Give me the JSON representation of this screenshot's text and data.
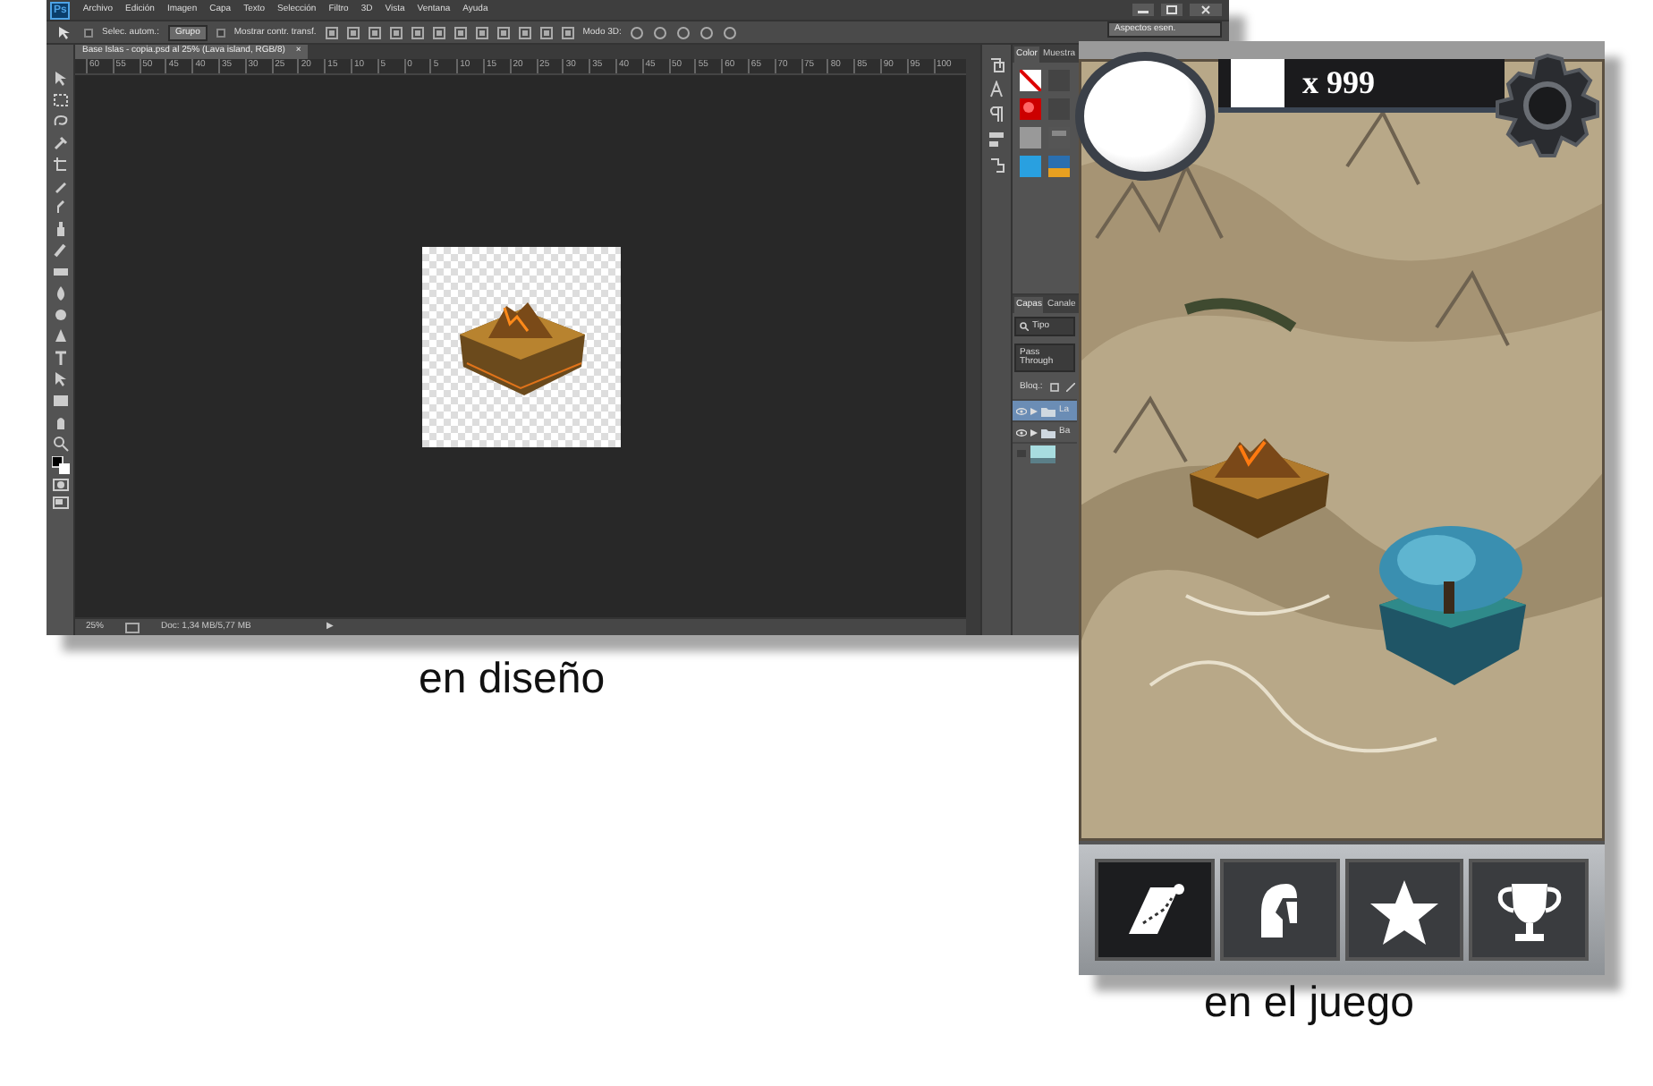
{
  "photoshop": {
    "logo": "Ps",
    "menu": [
      "Archivo",
      "Edición",
      "Imagen",
      "Capa",
      "Texto",
      "Selección",
      "Filtro",
      "3D",
      "Vista",
      "Ventana",
      "Ayuda"
    ],
    "options_bar": {
      "auto_select": {
        "label": "Selec. autom.:",
        "checked": false,
        "value": "Grupo"
      },
      "transform_controls": {
        "label": "Mostrar contr. transf.",
        "checked": false
      },
      "mode_3d_label": "Modo 3D:",
      "workspace": "Aspectos esen."
    },
    "document_tab": {
      "title": "Base Islas - copia.psd al 25% (Lava island, RGB/8)",
      "close": "×"
    },
    "ruler_labels": [
      "60",
      "55",
      "50",
      "45",
      "40",
      "35",
      "30",
      "25",
      "20",
      "15",
      "10",
      "5",
      "0",
      "5",
      "10",
      "15",
      "20",
      "25",
      "30",
      "35",
      "40",
      "45",
      "50",
      "55",
      "60",
      "65",
      "70",
      "75",
      "80",
      "85",
      "90",
      "95",
      "100"
    ],
    "panels": {
      "color_tabs": [
        {
          "label": "Color",
          "selected": true
        },
        {
          "label": "Muestra",
          "selected": false
        }
      ],
      "layer_tabs": [
        {
          "label": "Capas",
          "selected": true
        },
        {
          "label": "Canale",
          "selected": false
        }
      ],
      "filter_kind": "Tipo",
      "blend_mode": "Pass Through",
      "lock_label": "Bloq.:",
      "layers": [
        {
          "name": "La",
          "visible": true,
          "selected": true
        },
        {
          "name": "Ba",
          "visible": true,
          "selected": false
        }
      ]
    },
    "status_bar": {
      "zoom": "25%",
      "doc_size": "Doc: 1,34 MB/5,77 MB",
      "arrow": "▶"
    }
  },
  "caption_design": "en diseño",
  "game": {
    "counter": "x 999",
    "tabs": [
      {
        "kind": "map",
        "selected": true
      },
      {
        "kind": "helmet",
        "selected": false
      },
      {
        "kind": "star",
        "selected": false
      },
      {
        "kind": "trophy",
        "selected": false
      }
    ]
  },
  "caption_game": "en el juego"
}
